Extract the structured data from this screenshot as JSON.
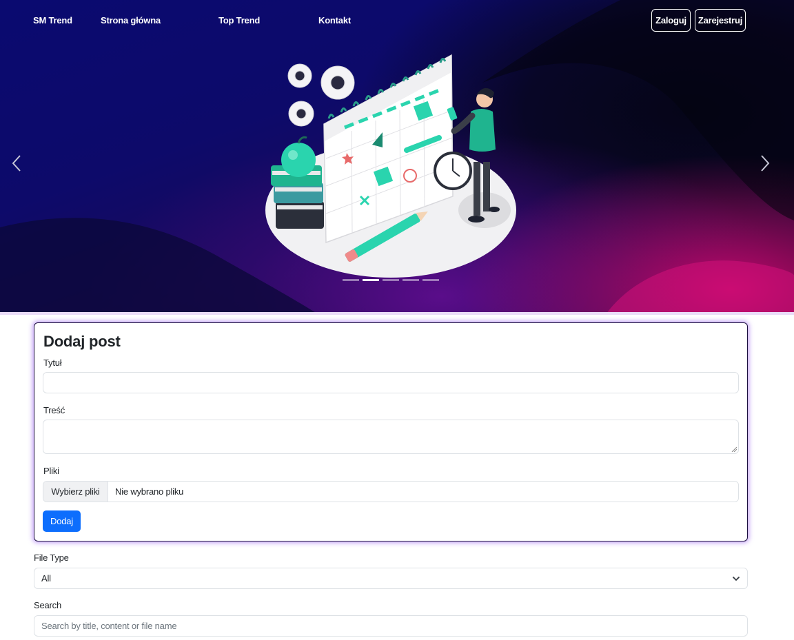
{
  "nav": {
    "brand": "SM Trend",
    "links": [
      "Strona główna",
      "Top Trend",
      "Kontakt"
    ],
    "login_label": "Zaloguj",
    "register_label": "Zarejestruj"
  },
  "carousel": {
    "slide_count": 5,
    "active_index": 1,
    "prev_icon": "chevron-left-icon",
    "next_icon": "chevron-right-icon"
  },
  "post_form": {
    "title": "Dodaj post",
    "title_label": "Tytuł",
    "title_value": "",
    "content_label": "Treść",
    "content_value": "",
    "files_label": "Pliki",
    "files_button": "Wybierz pliki",
    "files_status": "Nie wybrano pliku",
    "submit_label": "Dodaj"
  },
  "filters": {
    "file_type_label": "File Type",
    "file_type_selected": "All",
    "search_label": "Search",
    "search_placeholder": "Search by title, content or file name",
    "search_value": ""
  },
  "colors": {
    "primary": "#0d6efd",
    "accent_teal": "#2ad4ae",
    "card_glow": "#9a5af0",
    "hero_navy": "#0a0a70",
    "hero_magenta": "#c0086a"
  }
}
